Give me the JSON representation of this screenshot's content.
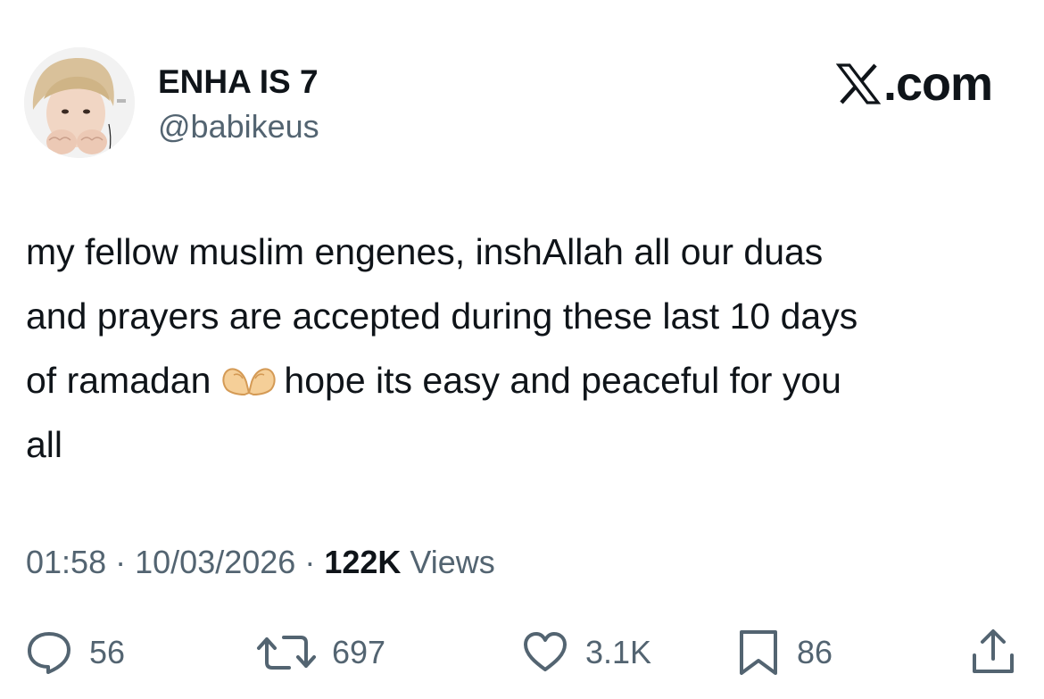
{
  "user": {
    "display_name": "ENHA IS 7",
    "handle": "@babikeus",
    "avatar_icon": "profile-photo"
  },
  "brand": {
    "logo_icon": "x-logo-icon",
    "text": ".com"
  },
  "tweet": {
    "lines": [
      "my fellow muslim engenes, inshAllah all our duas",
      "and prayers are accepted during these last 10 days",
      "of ramadan",
      "hope its easy and peaceful for you",
      "all"
    ],
    "emoji_icon": "heart-hands-emoji-icon"
  },
  "meta": {
    "time": "01:58",
    "separator": "·",
    "date": "10/03/2026",
    "views_count": "122K",
    "views_label": "Views"
  },
  "actions": {
    "replies": {
      "icon": "reply-icon",
      "count": "56"
    },
    "reposts": {
      "icon": "repost-icon",
      "count": "697"
    },
    "likes": {
      "icon": "heart-icon",
      "count": "3.1K"
    },
    "bookmarks": {
      "icon": "bookmark-icon",
      "count": "86"
    },
    "share": {
      "icon": "share-icon"
    }
  },
  "colors": {
    "text_primary": "#0f1419",
    "text_secondary": "#536471",
    "background": "#ffffff"
  }
}
